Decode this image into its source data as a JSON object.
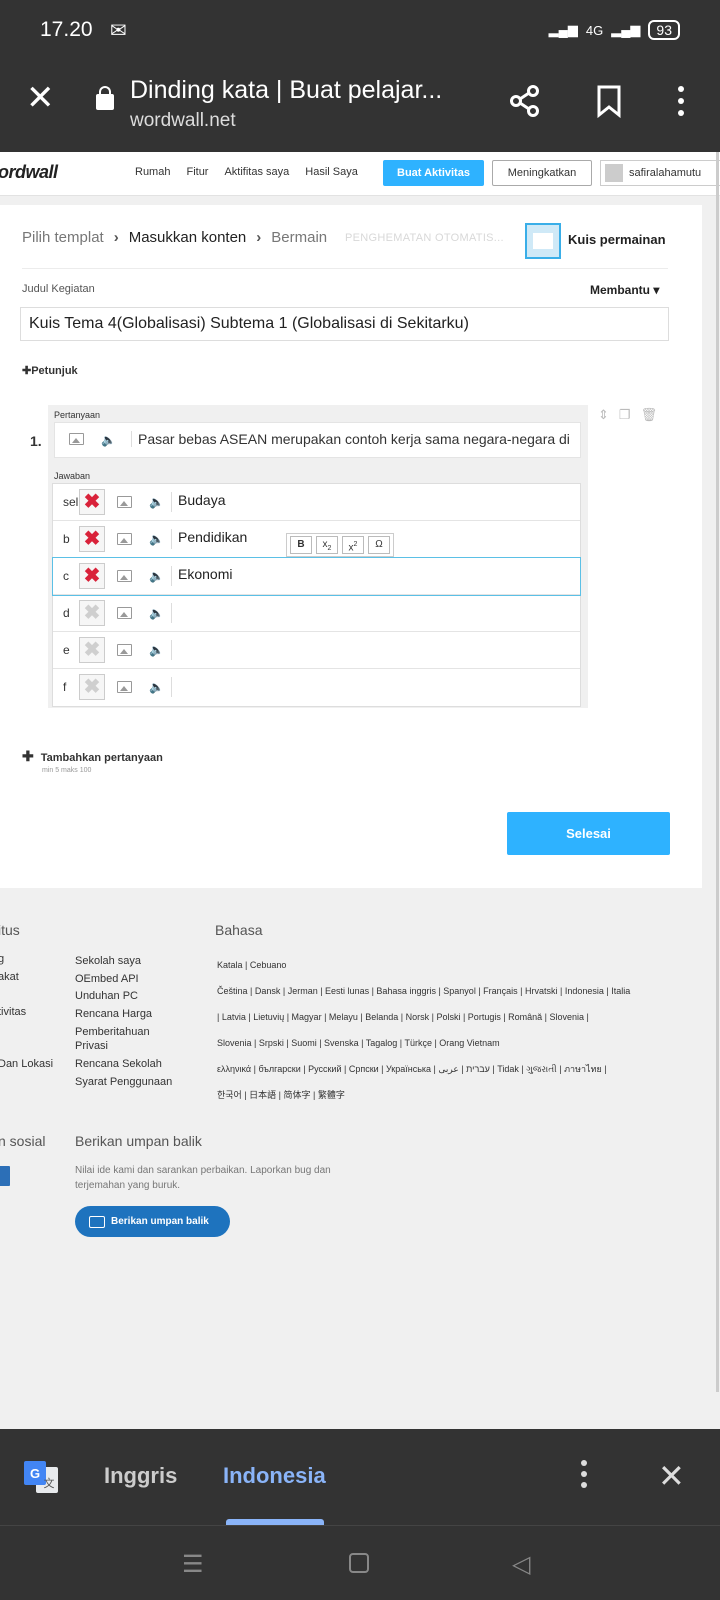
{
  "status": {
    "time": "17.20",
    "network": "4G",
    "battery": "93"
  },
  "browser": {
    "title": "Dinding kata | Buat pelajar...",
    "url": "wordwall.net"
  },
  "site": {
    "logo": "ordwall",
    "nav": [
      "Rumah",
      "Fitur",
      "Aktifitas saya",
      "Hasil Saya"
    ],
    "create_label": "Buat Aktivitas",
    "upgrade_label": "Meningkatkan",
    "user": "safiralahamutu"
  },
  "editor": {
    "crumbs": [
      "Pilih templat",
      "Masukkan konten",
      "Bermain"
    ],
    "autosave": "PENGHEMATAN OTOMATIS...",
    "template_name": "Kuis permainan",
    "title_label": "Judul Kegiatan",
    "help_label": "Membantu",
    "title_value": "Kuis Tema 4(Globalisasi) Subtema 1 (Globalisasi di Sekitarku)",
    "instructions_label": "Petunjuk",
    "question_number": "1.",
    "question_label": "Pertanyaan",
    "question_text": "Pasar bebas ASEAN merupakan contoh kerja sama negara-negara di",
    "answers_label": "Jawaban",
    "answers": [
      {
        "letter": "sel",
        "text": "Budaya",
        "marked": true
      },
      {
        "letter": "b",
        "text": "Pendidikan",
        "marked": true
      },
      {
        "letter": "c",
        "text": "Ekonomi",
        "marked": true
      },
      {
        "letter": "d",
        "text": "",
        "marked": false
      },
      {
        "letter": "e",
        "text": "",
        "marked": false
      },
      {
        "letter": "f",
        "text": "",
        "marked": false
      }
    ],
    "toolbar": {
      "bold": "B",
      "sub": "x",
      "sup": "x",
      "sub_mark": "2",
      "sup_mark": "2",
      "omega": "Ω"
    },
    "add_question": "Tambahkan pertanyaan",
    "minmax": "min 5 maks 100",
    "done_label": "Selesai"
  },
  "footer": {
    "site_heading": "itus",
    "left_links": [
      "g",
      "akat",
      "",
      "tivitas",
      "",
      "Dan Lokasi"
    ],
    "links": [
      "Sekolah saya",
      "OEmbed API",
      "Unduhan PC",
      "Rencana Harga",
      "Pemberitahuan",
      "Privasi",
      "Rencana Sekolah",
      "Syarat Penggunaan"
    ],
    "lang_heading": "Bahasa",
    "lang_lines": [
      "Katala | Cebuano",
      "Čeština | Dansk | Jerman | Eesti lunas | Bahasa inggris | Spanyol | Français | Hrvatski | Indonesia | Italia",
      "| Latvia | Lietuvių | Magyar | Melayu | Belanda | Norsk | Polski | Portugis | Română | Slovenia |",
      "Slovenia | Srpski | Suomi | Svenska | Tagalog | Türkçe | Orang Vietnam",
      "ελληνικά | български | Русский | Српски | Українська | עברית | عربى | Tidak | ગુજરાતી | ภาษาไทย |",
      "한국어 | 日本語 | 简体字 | 繁體字"
    ],
    "social_heading": "n sosial",
    "feedback_heading": "Berikan umpan balik",
    "feedback_text": "Nilai ide kami dan sarankan perbaikan. Laporkan bug dan terjemahan yang buruk.",
    "feedback_button": "Berikan umpan balik"
  },
  "translate": {
    "lang_a": "Inggris",
    "lang_b": "Indonesia"
  },
  "colors": {
    "accent": "#2eb2ff",
    "mark": "#d9223a",
    "chrome": "#333333"
  }
}
